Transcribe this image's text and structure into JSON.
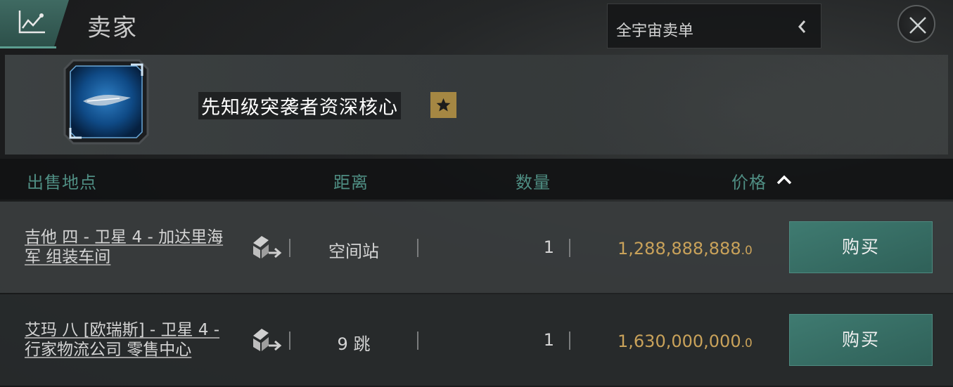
{
  "header": {
    "title": "卖家",
    "range_dropdown": "全宇宙卖单"
  },
  "item": {
    "name": "先知级突袭者资深核心",
    "badge_icon": "star-icon"
  },
  "columns": {
    "location": "出售地点",
    "distance": "距离",
    "quantity": "数量",
    "price": "价格"
  },
  "orders": [
    {
      "location_line1": "吉他 四 - 卫星 4 - 加达里海",
      "location_line2": "军 组装车间",
      "distance": "空间站",
      "quantity": "1",
      "price_main": "1,288,888,888",
      "price_decimal": ".0",
      "buy_label": "购买"
    },
    {
      "location_line1": "艾玛 八 [欧瑞斯] - 卫星 4 -",
      "location_line2": "行家物流公司 零售中心",
      "distance": "9 跳",
      "quantity": "1",
      "price_main": "1,630,000,000",
      "price_decimal": ".0",
      "buy_label": "购买"
    }
  ],
  "colors": {
    "accent_teal": "#4f8e83",
    "price_gold": "#c9a25a",
    "button_teal": "#3f7b71"
  }
}
